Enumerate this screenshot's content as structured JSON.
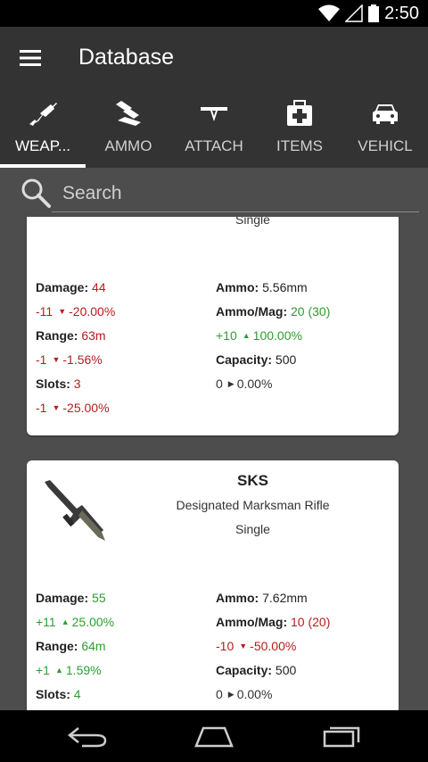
{
  "status": {
    "time": "2:50"
  },
  "app": {
    "title": "Database"
  },
  "tabs": [
    {
      "label": "WEAP...",
      "icon": "rifle-icon",
      "active": true
    },
    {
      "label": "AMMO",
      "icon": "ammo-icon",
      "active": false
    },
    {
      "label": "ATTACH",
      "icon": "attachment-icon",
      "active": false
    },
    {
      "label": "ITEMS",
      "icon": "medkit-icon",
      "active": false
    },
    {
      "label": "VEHICL",
      "icon": "car-icon",
      "active": false
    }
  ],
  "search": {
    "placeholder": "Search"
  },
  "cards": [
    {
      "fire_mode": "Single",
      "damage": {
        "label": "Damage:",
        "value": "44",
        "delta": "-11",
        "pct": "-20.00%",
        "trend": "down"
      },
      "range": {
        "label": "Range:",
        "value": "63m",
        "delta": "-1",
        "pct": "-1.56%",
        "trend": "down"
      },
      "slots": {
        "label": "Slots:",
        "value": "3",
        "delta": "-1",
        "pct": "-25.00%",
        "trend": "down"
      },
      "ammo": {
        "label": "Ammo:",
        "value": "5.56mm"
      },
      "ammo_mag": {
        "label": "Ammo/Mag:",
        "value": "20",
        "extended": "(30)",
        "delta": "+10",
        "pct": "100.00%",
        "trend": "up"
      },
      "capacity": {
        "label": "Capacity:",
        "value": "500",
        "delta": "0",
        "pct": "0.00%",
        "trend": "neutral"
      }
    },
    {
      "name": "SKS",
      "type": "Designated Marksman Rifle",
      "fire_mode": "Single",
      "damage": {
        "label": "Damage:",
        "value": "55",
        "delta": "+11",
        "pct": "25.00%",
        "trend": "up"
      },
      "range": {
        "label": "Range:",
        "value": "64m",
        "delta": "+1",
        "pct": "1.59%",
        "trend": "up"
      },
      "slots": {
        "label": "Slots:",
        "value": "4"
      },
      "ammo": {
        "label": "Ammo:",
        "value": "7.62mm"
      },
      "ammo_mag": {
        "label": "Ammo/Mag:",
        "value": "10",
        "extended": "(20)",
        "delta": "-10",
        "pct": "-50.00%",
        "trend": "down"
      },
      "capacity": {
        "label": "Capacity:",
        "value": "500",
        "delta": "0",
        "pct": "0.00%",
        "trend": "neutral"
      }
    }
  ],
  "colors": {
    "toolbar": "#333333",
    "background": "#4d4d4d",
    "negative": "#b71c1c",
    "positive": "#2e9e2e"
  },
  "trend_glyphs": {
    "up": "▲",
    "down": "▼",
    "neutral": "▶"
  }
}
